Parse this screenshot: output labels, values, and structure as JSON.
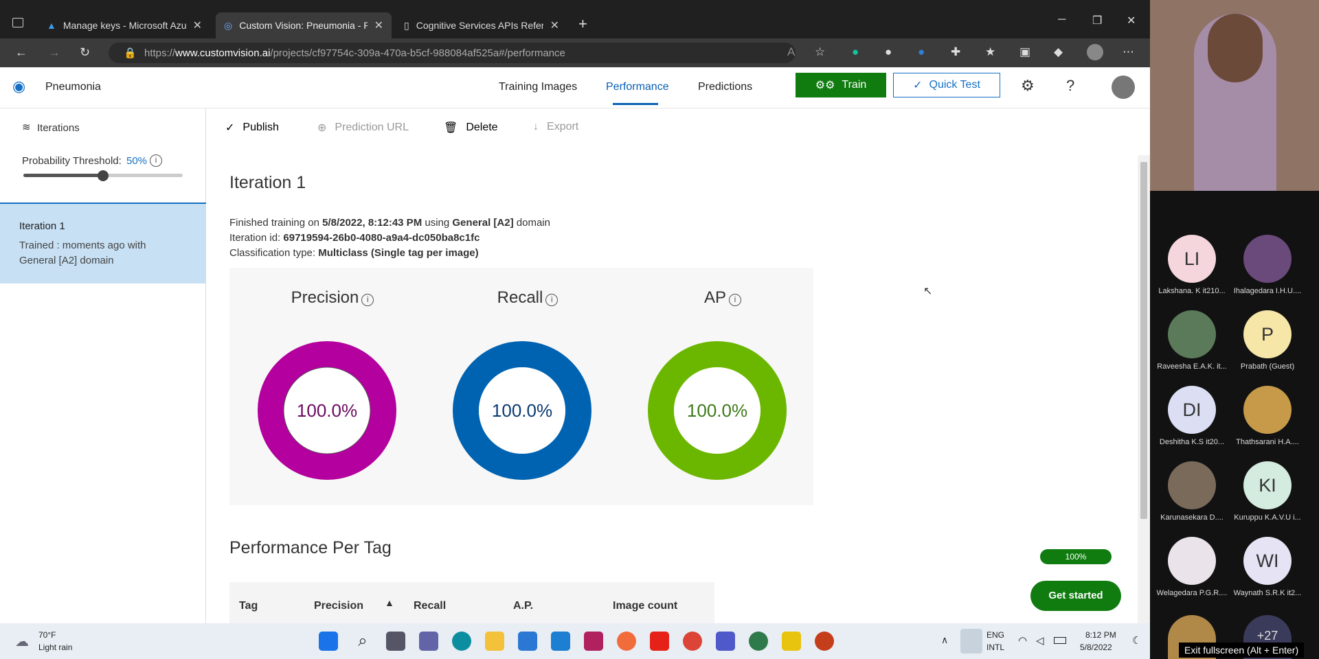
{
  "browser": {
    "tabs": [
      {
        "title": "Manage keys - Microsoft Azure",
        "icon": "azure-icon"
      },
      {
        "title": "Custom Vision: Pneumonia - Per",
        "icon": "customvision-icon"
      },
      {
        "title": "Cognitive Services APIs Referenc",
        "icon": "document-icon"
      }
    ],
    "active_tab": 1,
    "url_prefix": "https://",
    "url_host": "www.customvision.ai",
    "url_path": "/projects/cf97754c-309a-470a-b5cf-988084af525a#/performance"
  },
  "app": {
    "project_name": "Pneumonia",
    "nav": {
      "training_images": "Training Images",
      "performance": "Performance",
      "predictions": "Predictions"
    },
    "train_label": "Train",
    "quick_test_label": "Quick Test",
    "accent": "#0a5fb4",
    "train_color": "#107c10"
  },
  "sidebar": {
    "iterations_label": "Iterations",
    "threshold_label": "Probability Threshold:",
    "threshold_value": "50%",
    "threshold_fraction": 0.5,
    "iteration": {
      "name": "Iteration 1",
      "line1": "Trained : moments ago with",
      "line2": "General [A2] domain"
    }
  },
  "toolbar": {
    "publish": "Publish",
    "prediction_url": "Prediction URL",
    "delete": "Delete",
    "export": "Export"
  },
  "iteration": {
    "title": "Iteration 1",
    "finished_prefix": "Finished training on ",
    "finished_date": "5/8/2022, 8:12:43 PM",
    "using": " using ",
    "domain": "General [A2]",
    "domain_suffix": " domain",
    "id_label": "Iteration id: ",
    "id_value": "69719594-26b0-4080-a9a4-dc050ba8c1fc",
    "class_label": "Classification type: ",
    "class_value": "Multiclass (Single tag per image)"
  },
  "metrics": [
    {
      "label": "Precision",
      "value": "100.0%",
      "fraction": 1.0,
      "color": "#b4009e"
    },
    {
      "label": "Recall",
      "value": "100.0%",
      "fraction": 1.0,
      "color": "#0063b1"
    },
    {
      "label": "AP",
      "value": "100.0%",
      "fraction": 1.0,
      "color": "#6bb700"
    }
  ],
  "per_tag": {
    "title": "Performance Per Tag",
    "columns": [
      "Tag",
      "Precision",
      "Recall",
      "A.P.",
      "Image count"
    ]
  },
  "get_started": {
    "progress": "100%",
    "button": "Get started"
  },
  "taskbar": {
    "weather_temp": "70°F",
    "weather_desc": "Light rain",
    "lang1": "ENG",
    "lang2": "INTL",
    "time": "8:12 PM",
    "date": "5/8/2022"
  },
  "participants": [
    {
      "initials": "LI",
      "name": "Lakshana. K it210...",
      "color": "#f4d6dc"
    },
    {
      "initials": "",
      "name": "Ihalagedara I.H.U....",
      "color": "#6a4a7a"
    },
    {
      "initials": "",
      "name": "Raveesha E.A.K. it...",
      "color": "#5a7a5a"
    },
    {
      "initials": "P",
      "name": "Prabath (Guest)",
      "color": "#f6e6a8"
    },
    {
      "initials": "DI",
      "name": "Deshitha K.S it20...",
      "color": "#dcdff4"
    },
    {
      "initials": "",
      "name": "Thathsarani H.A....",
      "color": "#c79a4a"
    },
    {
      "initials": "",
      "name": "Karunasekara D....",
      "color": "#7a6a5a"
    },
    {
      "initials": "KI",
      "name": "Kuruppu K.A.V.U i...",
      "color": "#d4ecdf"
    },
    {
      "initials": "",
      "name": "Welagedara P.G.R....",
      "color": "#eae4ea"
    },
    {
      "initials": "WI",
      "name": "Waynath S.R.K it2...",
      "color": "#e6e4f4"
    }
  ],
  "participants_more": "+27",
  "fullscreen_hint": "Exit fullscreen (Alt + Enter)"
}
